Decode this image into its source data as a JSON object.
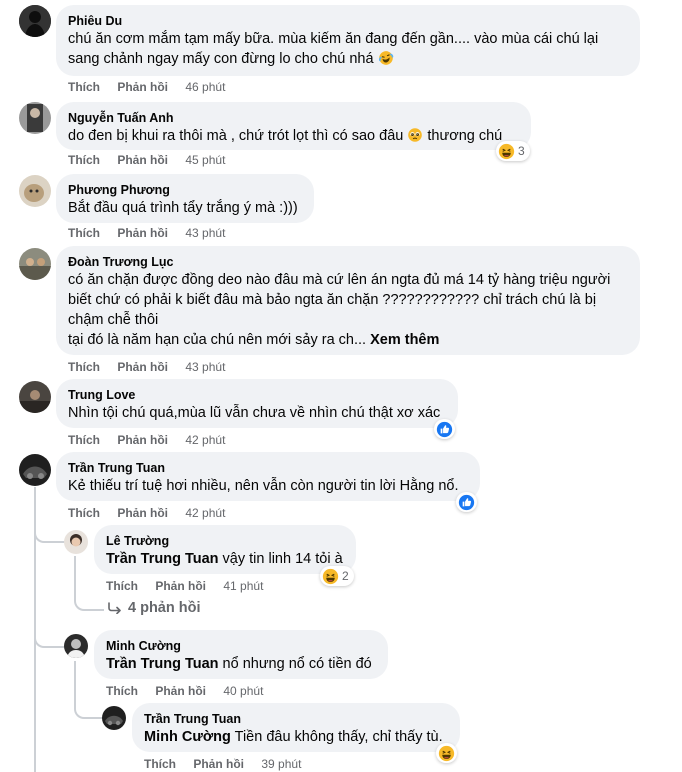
{
  "actions": {
    "like": "Thích",
    "reply": "Phản hồi"
  },
  "comments": [
    {
      "author": "Phiêu Du",
      "lines": [
        "chú ăn cơm mắm tạm mấy bữa. mùa kiếm ăn đang đến gần.... vào mùa cái chú lại",
        "sang chảnh ngay mấy con đừng lo cho chú nhá"
      ],
      "emoji": "laugh-cry-emoji",
      "time": "46 phút"
    },
    {
      "author": "Nguyễn Tuấn Anh",
      "lines": [
        "do đen bị khui ra thôi mà , chứ trót lọt thì có sao đâu",
        "thương chú"
      ],
      "emoji": "pleading-emoji",
      "time": "45 phút",
      "reaction": {
        "type": "haha",
        "count": "3"
      }
    },
    {
      "author": "Phương Phương",
      "lines": [
        "Bắt đầu quá trình tẩy trắng ý mà :)))"
      ],
      "time": "43 phút"
    },
    {
      "author": "Đoàn Trương Lục",
      "lines": [
        "có ăn chặn được đồng deo nào đâu mà cứ lên án ngta đủ má 14 tỷ hàng triệu người",
        "biết chứ có phải k biết đâu mà bảo ngta ăn chặn ???????????? chỉ trách chú là bị",
        "chậm chễ thôi",
        "tại đó là năm hạn của chú nên mới sảy ra ch..."
      ],
      "see_more": "Xem thêm",
      "time": "43 phút"
    },
    {
      "author": "Trung Love",
      "lines": [
        "Nhìn tội chú quá,mùa lũ vẫn chưa về nhìn chú thật xơ xác"
      ],
      "time": "42 phút",
      "reaction": {
        "type": "like",
        "count": ""
      }
    },
    {
      "author": "Trần Trung Tuan",
      "lines": [
        "Kẻ thiếu trí tuệ hơi nhiều, nên vẫn còn người tin lời Hằng nổ."
      ],
      "time": "42 phút",
      "reaction": {
        "type": "like",
        "count": ""
      }
    }
  ],
  "replies": [
    {
      "author": "Lê Trường",
      "tag": "Trần Trung Tuan",
      "text": "vậy tin linh 14 tỏi à",
      "time": "41 phút",
      "reaction": {
        "type": "haha",
        "count": "2"
      }
    },
    {
      "author": "Minh Cường",
      "tag": "Trần Trung Tuan",
      "text": "nổ nhưng nổ có tiền đó",
      "time": "40 phút"
    },
    {
      "author": "Trần Trung Tuan",
      "tag": "Minh Cường",
      "text": "Tiền đâu không thấy, chỉ thấy tù.",
      "time": "39 phút",
      "reaction": {
        "type": "haha",
        "count": ""
      }
    }
  ],
  "view_replies": "4 phản hồi",
  "colors": {
    "bubble": "#f0f2f5",
    "meta": "#65676b",
    "like_blue": "#1877f2",
    "haha_yellow": "#f7b928",
    "thread": "#ccd0d5"
  }
}
